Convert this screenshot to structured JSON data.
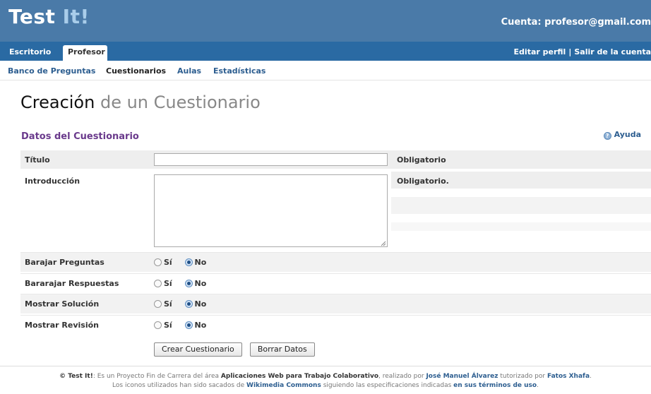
{
  "header": {
    "logo_main": "Test ",
    "logo_accent": "It!",
    "account_text": "Cuenta: profesor@gmail.com"
  },
  "nav": {
    "tabs": [
      {
        "label": "Escritorio"
      },
      {
        "label": "Profesor"
      }
    ],
    "edit_profile": "Editar perfil",
    "separator": "|",
    "logout": "Salir de la cuenta"
  },
  "subnav": {
    "items": [
      {
        "label": "Banco de Preguntas"
      },
      {
        "label": "Cuestionarios"
      },
      {
        "label": "Aulas"
      },
      {
        "label": "Estadísticas"
      }
    ]
  },
  "page": {
    "title_strong": "Creación",
    "title_rest": " de un Cuestionario"
  },
  "section": {
    "title": "Datos del Cuestionario",
    "help": "Ayuda"
  },
  "form": {
    "titulo": {
      "label": "Título",
      "value": "",
      "hint": "Obligatorio"
    },
    "intro": {
      "label": "Introducción",
      "value": "",
      "hint": "Obligatorio."
    },
    "options": [
      {
        "label": "Barajar Preguntas",
        "yes": "Sí",
        "no": "No",
        "selected": "no"
      },
      {
        "label": "Bararajar Respuestas",
        "yes": "Sí",
        "no": "No",
        "selected": "no"
      },
      {
        "label": "Mostrar Solución",
        "yes": "Sí",
        "no": "No",
        "selected": "no"
      },
      {
        "label": "Mostrar Revisión",
        "yes": "Sí",
        "no": "No",
        "selected": "no"
      }
    ],
    "submit_label": "Crear Cuestionario",
    "reset_label": "Borrar Datos"
  },
  "footer": {
    "line1_brand": "© Test It!",
    "line1_a": ": Es un Proyecto Fin de Carrera del área ",
    "line1_area": "Aplicaciones Web para Trabajo Colaborativo",
    "line1_b": ", realizado por ",
    "line1_author": "José Manuel Álvarez",
    "line1_c": " tutorizado por ",
    "line1_tutor": "Fatos Xhafa",
    "line1_d": ".",
    "line2_a": "Los iconos utilizados han sido sacados de ",
    "line2_source": "Wikimedia Commons",
    "line2_b": " siguiendo las especificaciones indicadas ",
    "line2_terms": "en sus términos de uso",
    "line2_c": "."
  },
  "colors": {
    "header_bg": "#4a7aa8",
    "nav_bg": "#2a6aa3",
    "section_title": "#6a3a8c",
    "link": "#2d5e90"
  }
}
